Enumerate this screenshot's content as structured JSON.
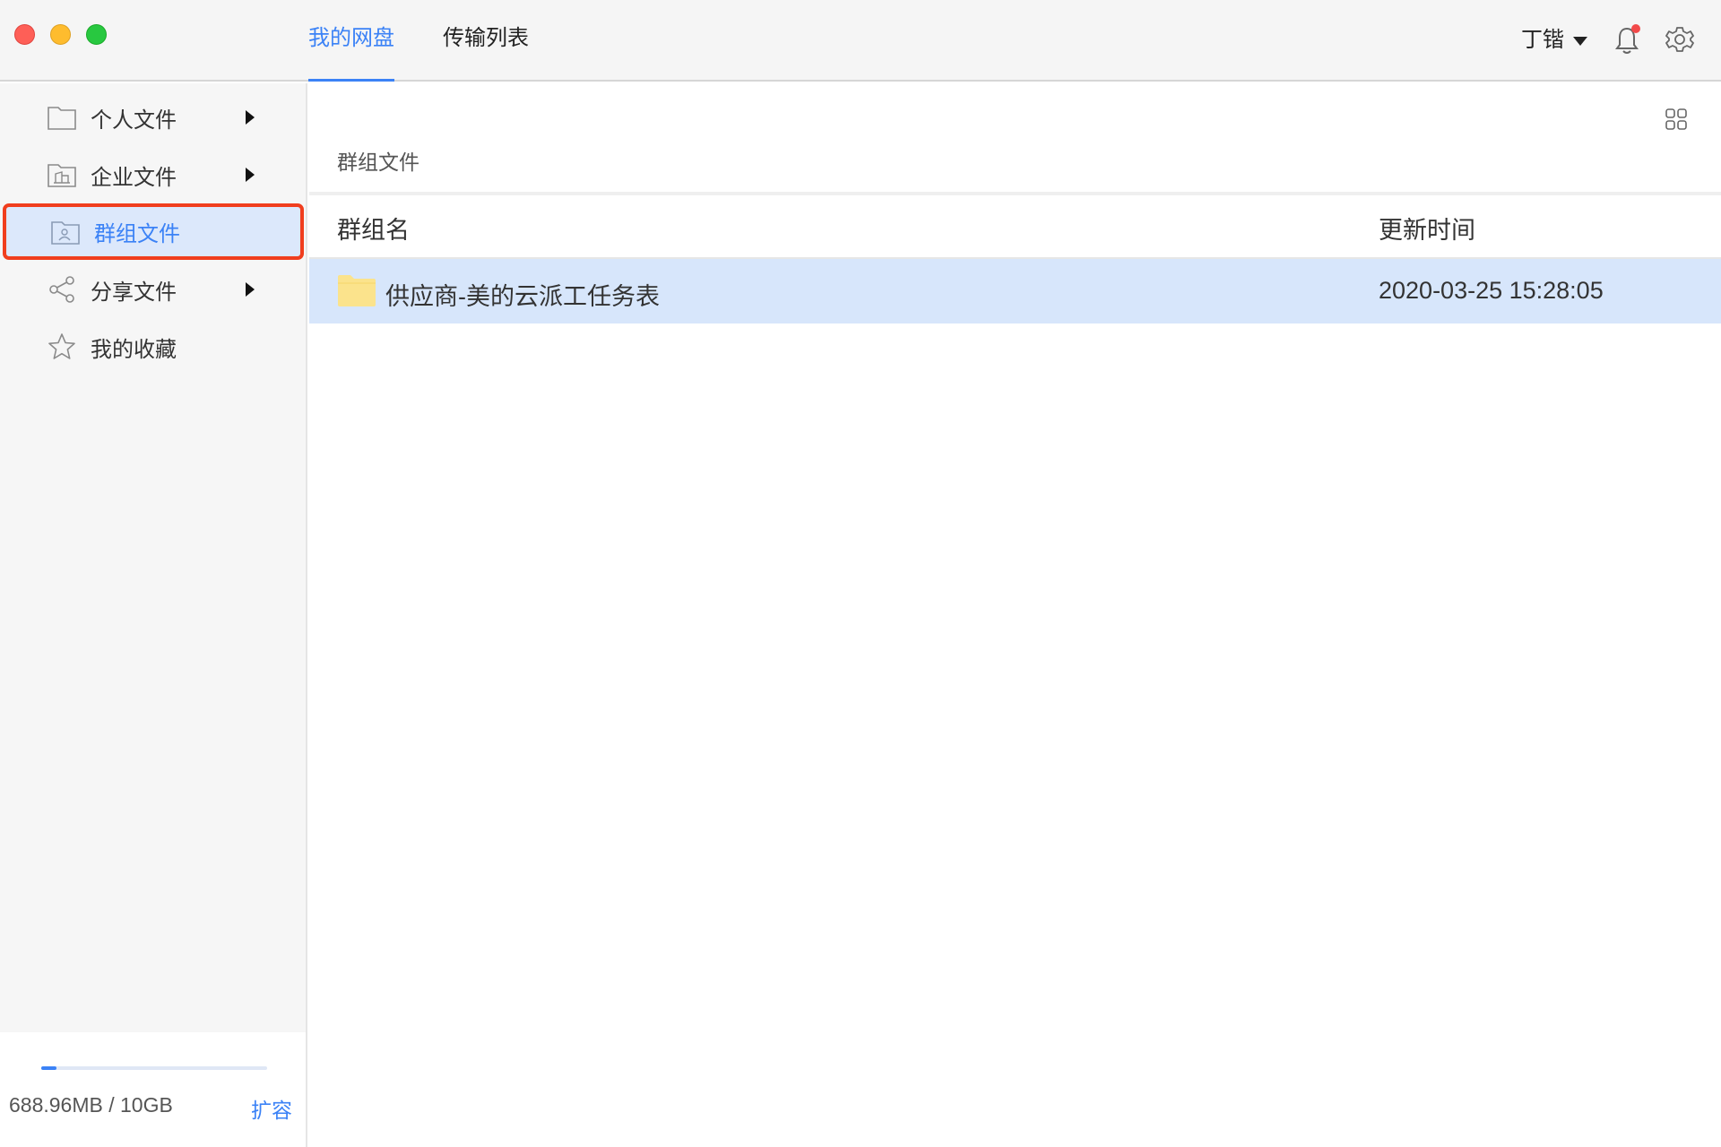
{
  "topbar": {
    "tabs": [
      {
        "label": "我的网盘",
        "active": true
      },
      {
        "label": "传输列表",
        "active": false
      }
    ],
    "user_name": "丁锴",
    "accent_color": "#3b82f6",
    "notification_dot_color": "#f24a4a"
  },
  "sidebar": {
    "items": [
      {
        "label": "个人文件",
        "icon": "folder-icon",
        "has_submenu": true
      },
      {
        "label": "企业文件",
        "icon": "enterprise-folder-icon",
        "has_submenu": true
      },
      {
        "label": "群组文件",
        "icon": "group-folder-icon",
        "has_submenu": false,
        "selected": true
      },
      {
        "label": "分享文件",
        "icon": "share-icon",
        "has_submenu": true
      },
      {
        "label": "我的收藏",
        "icon": "star-icon",
        "has_submenu": false
      }
    ],
    "storage": {
      "used_fraction": 0.067,
      "used_text": "688.96MB / 10GB",
      "expand_label": "扩容"
    }
  },
  "main": {
    "breadcrumb": "群组文件",
    "columns": {
      "name": "群组名",
      "updated": "更新时间"
    },
    "rows": [
      {
        "name": "供应商-美的云派工任务表",
        "updated": "2020-03-25 15:28:05",
        "icon": "folder-icon",
        "selected": true
      }
    ]
  }
}
